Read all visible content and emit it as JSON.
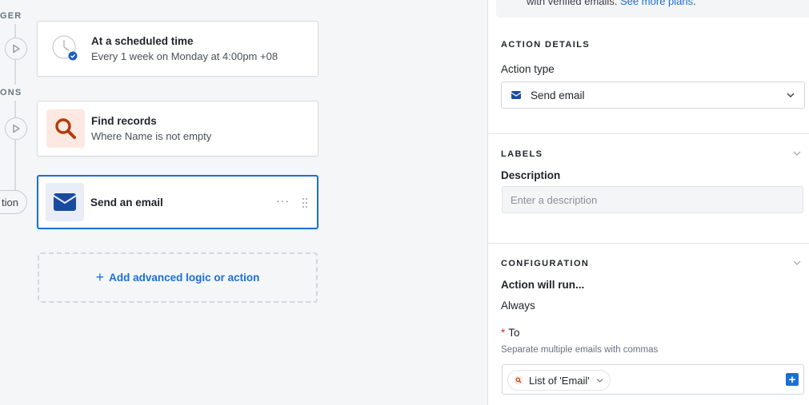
{
  "canvas": {
    "trigger_label": "GER",
    "actions_label": "ONS",
    "condition_pill": "tion",
    "cards": [
      {
        "title": "At a scheduled time",
        "subtitle": "Every 1 week on Monday at 4:00pm +08",
        "icon": "clock-icon"
      },
      {
        "title": "Find records",
        "subtitle": "Where Name is not empty",
        "icon": "search-icon"
      },
      {
        "title": "Send an email",
        "subtitle": "",
        "icon": "envelope-icon",
        "menu": "···"
      }
    ],
    "add_button": {
      "plus": "+",
      "label": "Add advanced logic or action"
    }
  },
  "panel": {
    "notice": {
      "text": "with verified emails.",
      "link": "See more plans",
      "trailing": "."
    },
    "action_details": {
      "heading": "ACTION DETAILS",
      "action_type_label": "Action type",
      "action_type_value": "Send email"
    },
    "labels": {
      "heading": "LABELS",
      "description_label": "Description",
      "description_placeholder": "Enter a description"
    },
    "configuration": {
      "heading": "CONFIGURATION",
      "run_label": "Action will run...",
      "run_value": "Always",
      "to_required": "*",
      "to_label": "To",
      "to_hint": "Separate multiple emails with commas",
      "to_token": "List of 'Email'",
      "add_symbol": "+"
    }
  },
  "colors": {
    "accent": "#1a6fd6",
    "required": "#d12b2b",
    "search_bg": "#fde9e1",
    "search_icon": "#b23a0c"
  }
}
